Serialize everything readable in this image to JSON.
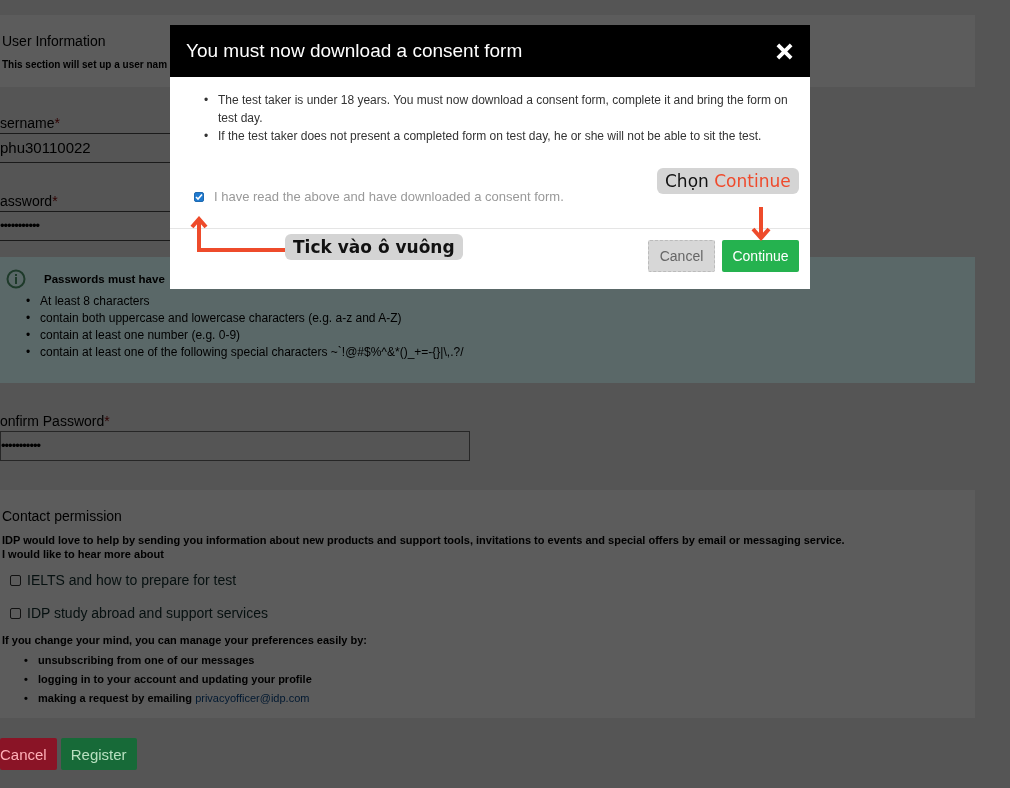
{
  "page": {
    "user_information": {
      "title": "User Information",
      "subtitle": "This section will set up a user nam"
    },
    "fields": [
      {
        "label": "sername",
        "required_mark": "*",
        "value": "phu30110022",
        "kind": "text"
      },
      {
        "label": "assword",
        "required_mark": "*",
        "value": "•••••••••••",
        "kind": "password"
      }
    ],
    "password_rules": {
      "title": "Passwords must have",
      "marker": "•",
      "items": [
        "At least 8 characters",
        "contain both uppercase and lowercase characters (e.g. a-z and A-Z)",
        "contain at least one number (e.g. 0-9)",
        "contain at least one of the following special characters ~`!@#$%^&*()_+=-{}|\\,.?/"
      ]
    },
    "confirm_field": {
      "label": "onfirm Password",
      "required_mark": "*",
      "value": "•••••••••••"
    },
    "contact_permission": {
      "title": "Contact permission",
      "intro": "IDP would love to help by sending you information about new products and support tools, invitations to events and special offers by email or messaging service.",
      "prompt": "I would like to hear more about",
      "options": [
        {
          "label": "IELTS and how to prepare for test",
          "checked": false
        },
        {
          "label": "IDP study abroad and support services",
          "checked": false
        }
      ],
      "preferences_text": "If you change your mind, you can manage your preferences easily by:",
      "preferences_marker": "•",
      "preferences": [
        {
          "text": "unsubscribing from one of our messages"
        },
        {
          "text": "logging in to your account and updating your profile"
        },
        {
          "text": "making a request by emailing",
          "link": "privacyofficer@idp.com"
        }
      ]
    },
    "buttons": [
      {
        "label": "Cancel",
        "kind": "danger"
      },
      {
        "label": "Register",
        "kind": "success"
      }
    ]
  },
  "modal": {
    "title": "You must now download a consent form",
    "marker": "•",
    "bullets": [
      "The test taker is under 18 years. You must now download a consent form, complete it and bring the form on test day.",
      "If the test taker does not present a completed form on test day, he or she will not be able to sit the test."
    ],
    "checkbox": {
      "label": "I have read the above and have downloaded a consent form.",
      "checked": true
    },
    "buttons": [
      {
        "label": "Cancel",
        "kind": "secondary"
      },
      {
        "label": "Continue",
        "kind": "primary"
      }
    ]
  },
  "annotations": [
    {
      "kind": "checkbox-hint",
      "text": "Tick vào ô vuông"
    },
    {
      "kind": "button-hint",
      "prefix": "Chọn",
      "highlight": "Continue"
    }
  ]
}
